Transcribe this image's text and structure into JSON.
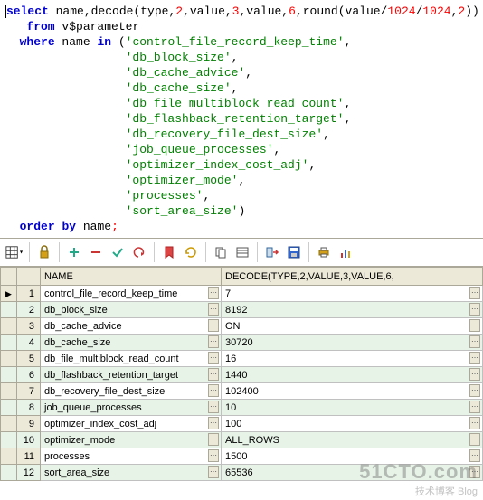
{
  "sql": {
    "kw_select": "select",
    "cols": " name,",
    "fn_decode": "decode",
    "decode_args_a": "(type,",
    "n2": "2",
    "c1": ",value,",
    "n3": "3",
    "c2": ",value,",
    "n6": "6",
    "c3": ",",
    "fn_round": "round",
    "round_args": "(value/",
    "n1024a": "1024",
    "slash": "/",
    "n1024b": "1024",
    "c4": ",",
    "n2b": "2",
    "close": "))",
    "kw_from": "from",
    "tbl": " v$parameter",
    "kw_where": "where",
    "where_clause": " name ",
    "kw_in": "in",
    "paren": " (",
    "strings": [
      "'control_file_record_keep_time'",
      "'db_block_size'",
      "'db_cache_advice'",
      "'db_cache_size'",
      "'db_file_multiblock_read_count'",
      "'db_flashback_retention_target'",
      "'db_recovery_file_dest_size'",
      "'job_queue_processes'",
      "'optimizer_index_cost_adj'",
      "'optimizer_mode'",
      "'processes'",
      "'sort_area_size'"
    ],
    "comma": ",",
    "close_paren": ")",
    "kw_order": "order",
    "kw_by": "by",
    "order_col": " name",
    "semi": ";"
  },
  "grid": {
    "col1": "NAME",
    "col2": "DECODE(TYPE,2,VALUE,3,VALUE,6,",
    "rows": [
      {
        "n": "1",
        "name": "control_file_record_keep_time",
        "val": "7"
      },
      {
        "n": "2",
        "name": "db_block_size",
        "val": "8192"
      },
      {
        "n": "3",
        "name": "db_cache_advice",
        "val": "ON"
      },
      {
        "n": "4",
        "name": "db_cache_size",
        "val": "30720"
      },
      {
        "n": "5",
        "name": "db_file_multiblock_read_count",
        "val": "16"
      },
      {
        "n": "6",
        "name": "db_flashback_retention_target",
        "val": "1440"
      },
      {
        "n": "7",
        "name": "db_recovery_file_dest_size",
        "val": "102400"
      },
      {
        "n": "8",
        "name": "job_queue_processes",
        "val": "10"
      },
      {
        "n": "9",
        "name": "optimizer_index_cost_adj",
        "val": "100"
      },
      {
        "n": "10",
        "name": "optimizer_mode",
        "val": "ALL_ROWS"
      },
      {
        "n": "11",
        "name": "processes",
        "val": "1500"
      },
      {
        "n": "12",
        "name": "sort_area_size",
        "val": "65536"
      }
    ]
  },
  "watermark": {
    "main": "51CTO.com",
    "sub": "技术博客  Blog"
  },
  "icons": {
    "grid": "grid-icon",
    "lock": "lock-icon",
    "add": "plus-icon",
    "del": "minus-icon",
    "commit": "check-icon",
    "rollback": "undo-icon",
    "bookmark": "bookmark-icon",
    "refresh": "refresh-icon",
    "copy": "copy-icon",
    "find": "find-icon",
    "link": "link-icon",
    "save": "save-icon",
    "print": "print-icon",
    "chart": "chart-icon"
  }
}
